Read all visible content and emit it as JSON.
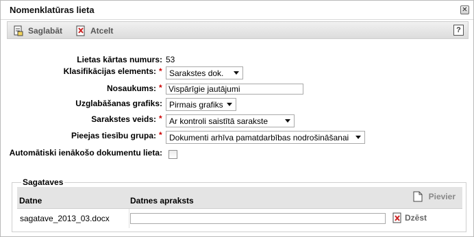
{
  "window": {
    "title": "Nomenklatūras lieta",
    "close_glyph": "✕"
  },
  "toolbar": {
    "save_label": "Saglabāt",
    "save_icon": "save-document-icon",
    "cancel_label": "Atcelt",
    "cancel_icon": "cancel-document-icon",
    "help_label": "?",
    "help_icon": "help-icon"
  },
  "form": {
    "case_number": {
      "label": "Lietas kārtas numurs:",
      "value": "53"
    },
    "classification": {
      "label": "Klasifikācijas elements:",
      "required": "*",
      "value": "Sarakstes dok."
    },
    "name": {
      "label": "Nosaukums:",
      "required": "*",
      "value": "Vispārīgie jautājumi"
    },
    "storage_schedule": {
      "label": "Uzglabāšanas grafiks:",
      "value": "Pirmais grafiks"
    },
    "correspondence_type": {
      "label": "Sarakstes veids:",
      "required": "*",
      "value": "Ar kontroli saistītā sarakste"
    },
    "access_group": {
      "label": "Pieejas tiesību grupa:",
      "required": "*",
      "value": "Dokumenti arhīva pamatdarbības nodrošināšanai"
    },
    "auto_incoming": {
      "label": "Automātiski ienākošo dokumentu lieta:",
      "checked": false
    }
  },
  "templates": {
    "legend": "Sagataves",
    "columns": {
      "file": "Datne",
      "description": "Datnes apraksts"
    },
    "add_label": "Pievier",
    "rows": [
      {
        "file": "sagatave_2013_03.docx",
        "description": "",
        "delete_label": "Dzēst"
      }
    ]
  },
  "colors": {
    "required": "#cc0000",
    "toolbar_bg": "#e4e4e4",
    "header_bg": "#e4e4e4"
  }
}
